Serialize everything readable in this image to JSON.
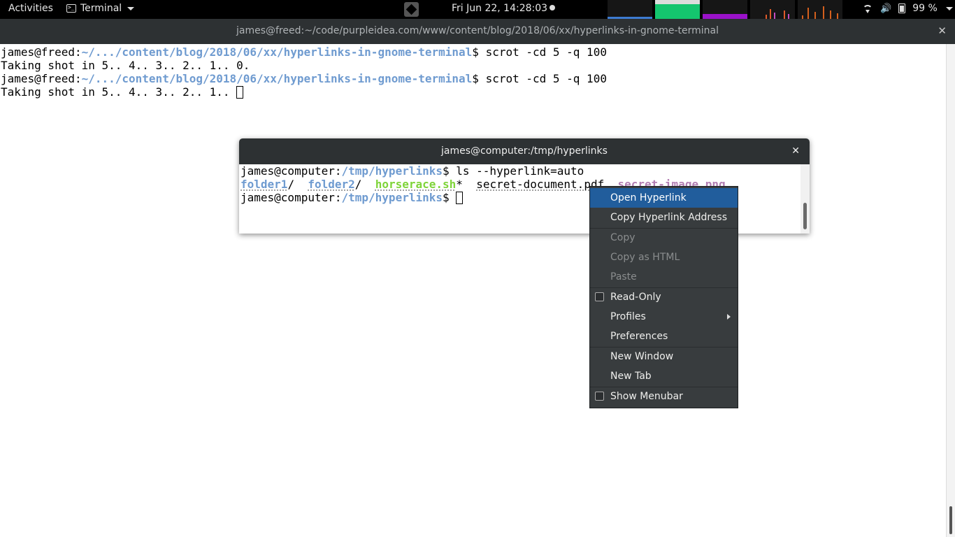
{
  "topbar": {
    "activities": "Activities",
    "app_name": "Terminal",
    "clock": "Fri Jun 22, 14:28:03",
    "battery": "99 %"
  },
  "outer_window": {
    "title": "james@freed:~/code/purpleidea.com/www/content/blog/2018/06/xx/hyperlinks-in-gnome-terminal",
    "lines": [
      {
        "prompt_user": "james@freed:",
        "path": "~/.../content/blog/2018/06/xx/hyperlinks-in-gnome-terminal",
        "cmd": "$ scrot -cd 5 -q 100"
      },
      {
        "text": "Taking shot in 5.. 4.. 3.. 2.. 1.. 0."
      },
      {
        "prompt_user": "james@freed:",
        "path": "~/.../content/blog/2018/06/xx/hyperlinks-in-gnome-terminal",
        "cmd": "$ scrot -cd 5 -q 100"
      },
      {
        "text": "Taking shot in 5.. 4.. 3.. 2.. 1.. "
      }
    ]
  },
  "inner_window": {
    "title": "james@computer:/tmp/hyperlinks",
    "prompt_user": "james@computer:",
    "path": "/tmp/hyperlinks",
    "cmd": "$ ls --hyperlink=auto",
    "prompt_end": "$ ",
    "files": {
      "folder1": "folder1",
      "folder1_suffix": "/",
      "folder2": "folder2",
      "folder2_suffix": "/",
      "script": "horserace.sh",
      "script_suffix": "*",
      "doc": "secret-document.pdf",
      "image": "secret-image.png"
    }
  },
  "context_menu": {
    "items": [
      {
        "label": "Open Hyperlink",
        "state": "selected"
      },
      {
        "label": "Copy Hyperlink Address",
        "state": "enabled"
      },
      {
        "label": "Copy",
        "state": "disabled"
      },
      {
        "label": "Copy as HTML",
        "state": "disabled"
      },
      {
        "label": "Paste",
        "state": "disabled"
      },
      {
        "label": "Read-Only",
        "state": "checkbox"
      },
      {
        "label": "Profiles",
        "state": "submenu"
      },
      {
        "label": "Preferences",
        "state": "enabled"
      },
      {
        "label": "New Window",
        "state": "enabled"
      },
      {
        "label": "New Tab",
        "state": "enabled"
      },
      {
        "label": "Show Menubar",
        "state": "checkbox"
      }
    ]
  },
  "colors": {
    "path": "#6f9bd0",
    "exec": "#7fd43a",
    "image": "#b37fb3",
    "menu_bg": "#383c3e",
    "menu_selected": "#215d9c",
    "titlebar": "#2d3133"
  }
}
